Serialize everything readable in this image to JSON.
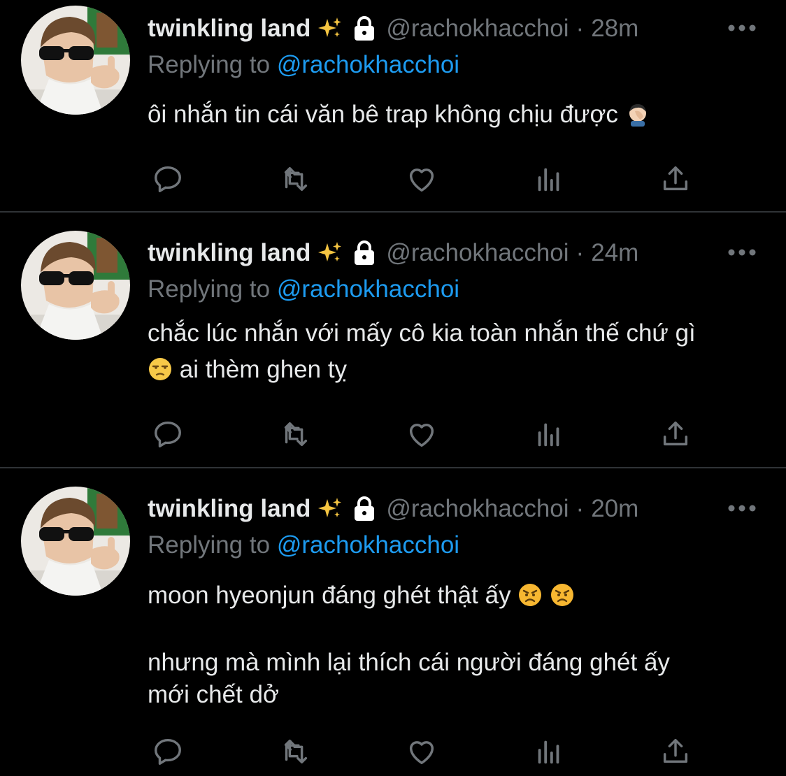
{
  "tweets": [
    {
      "display_name": "twinkling land",
      "handle": "@rachokhacchoi",
      "separator": "·",
      "time": "28m",
      "reply_prefix": "Replying to",
      "reply_mention": "@rachokhacchoi",
      "text_lines": [
        "ôi nhắn tin cái văn bê trap không chịu được"
      ],
      "trailing_emoji": "facepalm-emoji"
    },
    {
      "display_name": "twinkling land",
      "handle": "@rachokhacchoi",
      "separator": "·",
      "time": "24m",
      "reply_prefix": "Replying to",
      "reply_mention": "@rachokhacchoi",
      "text_lines": [
        "chắc lúc nhắn với mấy cô kia toàn nhắn thế chứ gì",
        "ai thèm ghen tỵ"
      ],
      "leading_emoji_line2": "unamused-face-emoji"
    },
    {
      "display_name": "twinkling land",
      "handle": "@rachokhacchoi",
      "separator": "·",
      "time": "20m",
      "reply_prefix": "Replying to",
      "reply_mention": "@rachokhacchoi",
      "text_lines": [
        "moon hyeonjun đáng ghét thật ấy",
        "nhưng mà mình lại thích cái người đáng ghét ấy",
        "mới chết dở"
      ],
      "trailing_emoji": "angry-face-emoji"
    }
  ],
  "icons": {
    "name_decoration": "sparkles-emoji",
    "protected": "lock-icon",
    "more": "more-icon",
    "actions": [
      "reply-icon",
      "retweet-icon",
      "like-icon",
      "analytics-icon",
      "share-icon"
    ]
  },
  "colors": {
    "background": "#000000",
    "text": "#e7e9ea",
    "muted": "#71767b",
    "link": "#1d9bf0",
    "divider": "#2f3336"
  }
}
